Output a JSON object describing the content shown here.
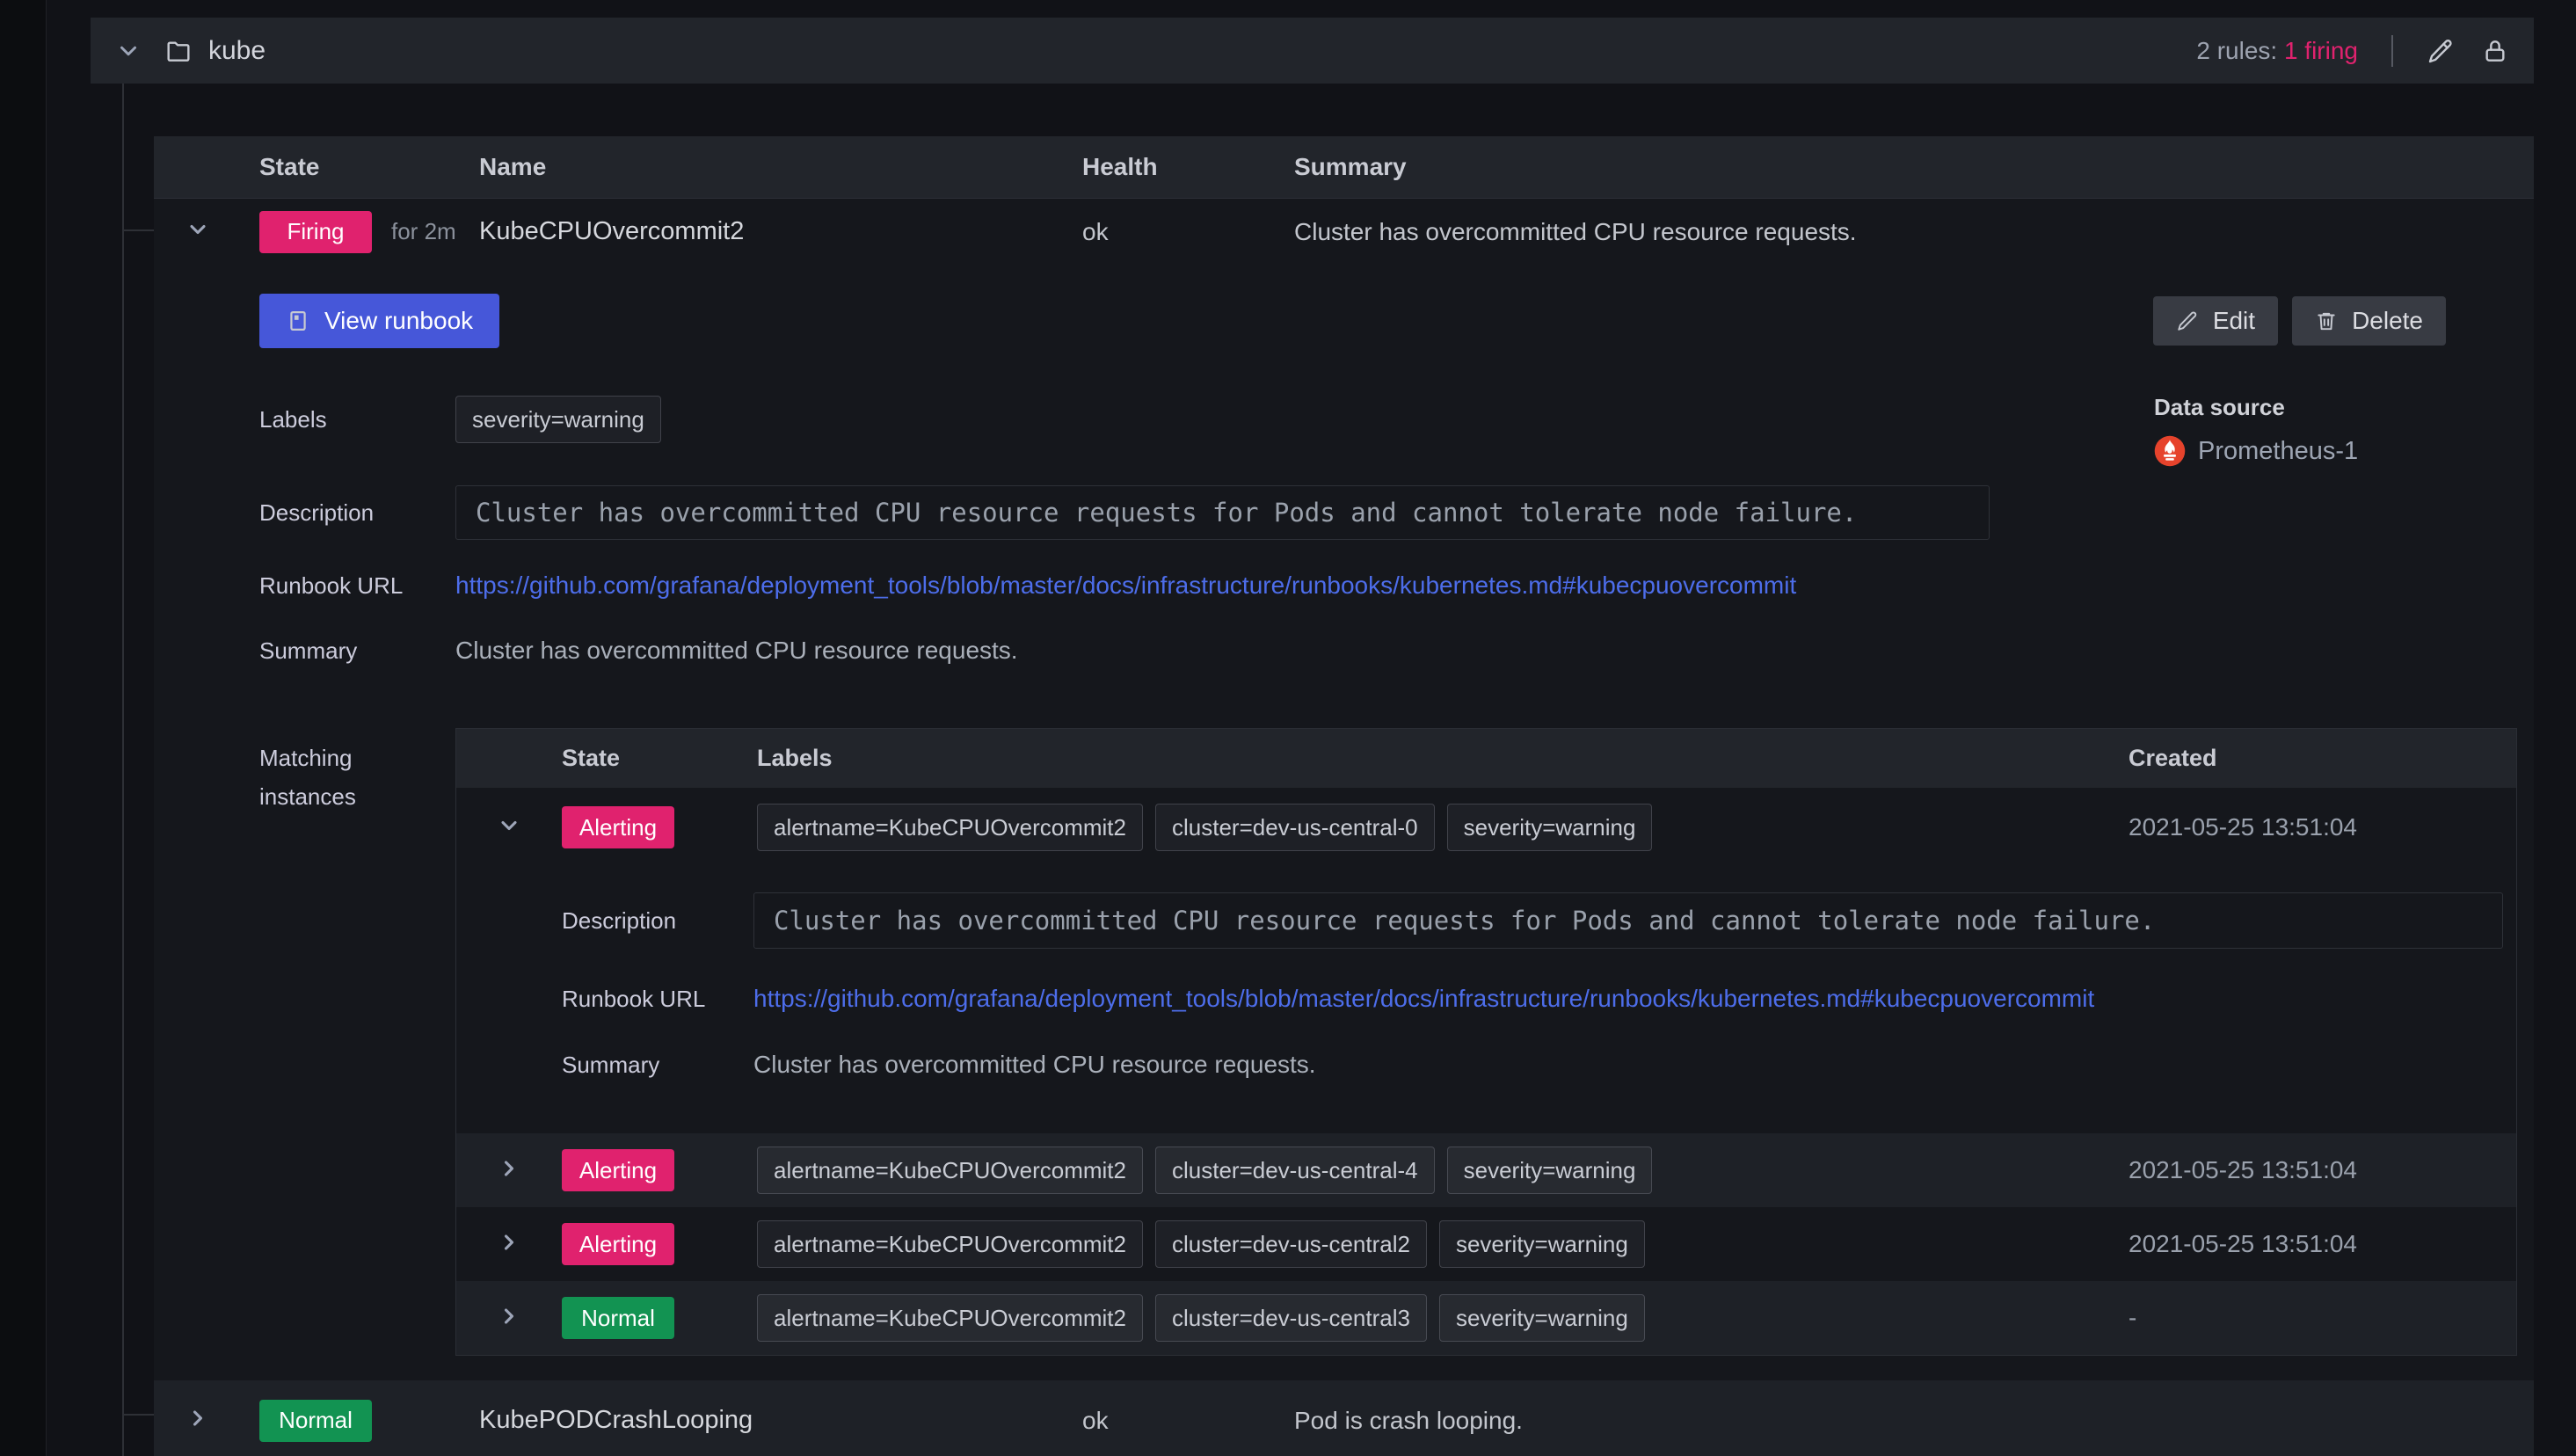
{
  "colors": {
    "firing_pink": "#e0226e",
    "normal_green": "#129352",
    "primary_button_blue": "#4657d9",
    "link_blue": "#4d6dea",
    "prometheus_red": "#e6432c",
    "panel_header": "#22252b",
    "canvas": "#111217"
  },
  "group": {
    "title": "kube",
    "rules_count": "2 rules:",
    "firing_count": "1 firing"
  },
  "rules_table": {
    "columns": {
      "state": "State",
      "name": "Name",
      "health": "Health",
      "summary": "Summary"
    },
    "rule1": {
      "state": "Firing",
      "for": "for 2m",
      "name": "KubeCPUOvercommit2",
      "health": "ok",
      "summary": "Cluster has overcommitted CPU resource requests.",
      "view_runbook": "View runbook",
      "edit": "Edit",
      "delete": "Delete",
      "labels_label": "Labels",
      "label_chip": "severity=warning",
      "datasource_label": "Data source",
      "datasource_name": "Prometheus-1",
      "description_label": "Description",
      "description": "Cluster has overcommitted CPU resource requests for Pods and cannot tolerate node failure.",
      "runbook_label": "Runbook URL",
      "runbook_url": "https://github.com/grafana/deployment_tools/blob/master/docs/infrastructure/runbooks/kubernetes.md#kubecpuovercommit",
      "summary_label": "Summary",
      "summary_value": "Cluster has overcommitted CPU resource requests.",
      "matching_label": "Matching instances",
      "instances": {
        "columns": {
          "state": "State",
          "labels": "Labels",
          "created": "Created"
        },
        "rows": [
          {
            "state": "Alerting",
            "labels": [
              "alertname=KubeCPUOvercommit2",
              "cluster=dev-us-central-0",
              "severity=warning"
            ],
            "created": "2021-05-25 13:51:04",
            "description_label": "Description",
            "description": "Cluster has overcommitted CPU resource requests for Pods and cannot tolerate node failure.",
            "runbook_label": "Runbook URL",
            "runbook_url": "https://github.com/grafana/deployment_tools/blob/master/docs/infrastructure/runbooks/kubernetes.md#kubecpuovercommit",
            "summary_label": "Summary",
            "summary_value": "Cluster has overcommitted CPU resource requests."
          },
          {
            "state": "Alerting",
            "labels": [
              "alertname=KubeCPUOvercommit2",
              "cluster=dev-us-central-4",
              "severity=warning"
            ],
            "created": "2021-05-25 13:51:04"
          },
          {
            "state": "Alerting",
            "labels": [
              "alertname=KubeCPUOvercommit2",
              "cluster=dev-us-central2",
              "severity=warning"
            ],
            "created": "2021-05-25 13:51:04"
          },
          {
            "state": "Normal",
            "labels": [
              "alertname=KubeCPUOvercommit2",
              "cluster=dev-us-central3",
              "severity=warning"
            ],
            "created": "-"
          }
        ]
      }
    },
    "rule2": {
      "state": "Normal",
      "name": "KubePODCrashLooping",
      "health": "ok",
      "summary": "Pod is crash looping."
    }
  }
}
